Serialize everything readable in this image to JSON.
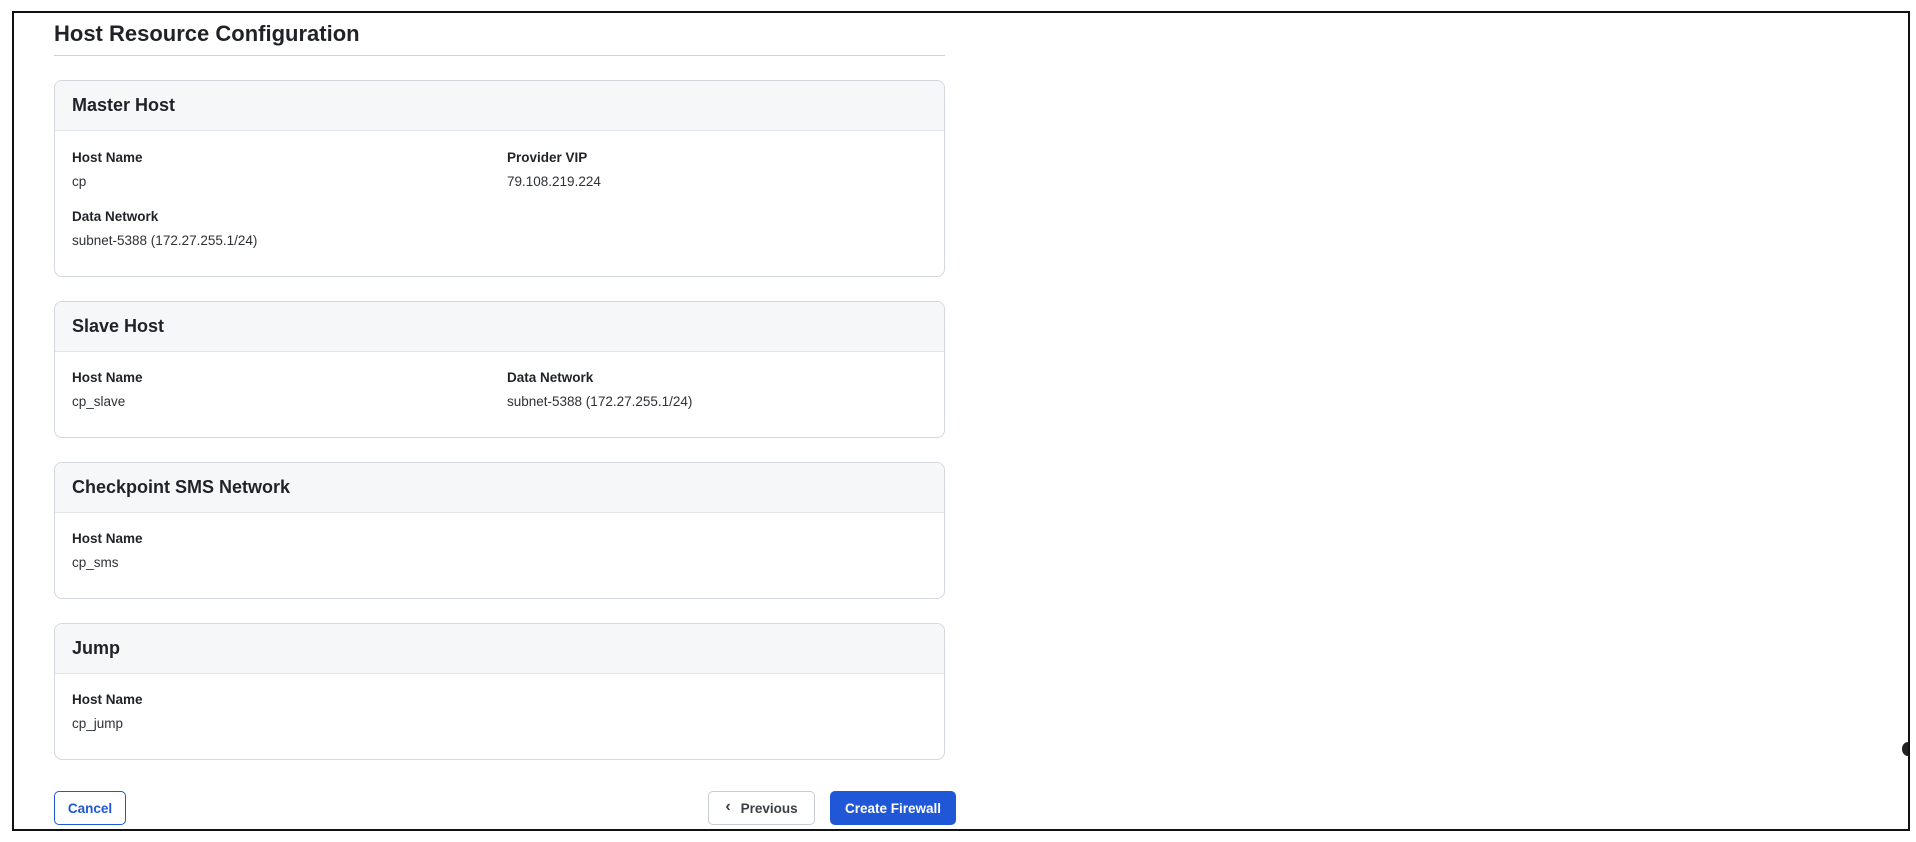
{
  "page": {
    "title": "Host Resource Configuration"
  },
  "cards": {
    "master": {
      "title": "Master Host",
      "host_name_label": "Host Name",
      "host_name_value": "cp",
      "provider_vip_label": "Provider VIP",
      "provider_vip_value": "79.108.219.224",
      "data_network_label": "Data Network",
      "data_network_value": "subnet-5388 (172.27.255.1/24)"
    },
    "slave": {
      "title": "Slave Host",
      "host_name_label": "Host Name",
      "host_name_value": "cp_slave",
      "data_network_label": "Data Network",
      "data_network_value": "subnet-5388 (172.27.255.1/24)"
    },
    "sms": {
      "title": "Checkpoint SMS Network",
      "host_name_label": "Host Name",
      "host_name_value": "cp_sms"
    },
    "jump": {
      "title": "Jump",
      "host_name_label": "Host Name",
      "host_name_value": "cp_jump"
    }
  },
  "actions": {
    "cancel_label": "Cancel",
    "previous_label": "Previous",
    "create_label": "Create Firewall"
  },
  "colors": {
    "primary": "#1f57d6",
    "card_header_bg": "#f6f7f9",
    "border": "#d3d7de"
  },
  "icons": {
    "previous": "chevron-left-icon"
  }
}
